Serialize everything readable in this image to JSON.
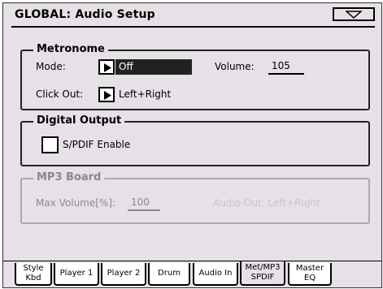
{
  "header": {
    "title": "GLOBAL: Audio Setup"
  },
  "metronome": {
    "title": "Metronome",
    "mode_label": "Mode:",
    "mode_value": "Off",
    "volume_label": "Volume:",
    "volume_value": "105",
    "click_out_label": "Click Out:",
    "click_out_value": "Left+Right"
  },
  "digital_output": {
    "title": "Digital Output",
    "spdif_label": "S/PDIF Enable",
    "spdif_checked": false
  },
  "mp3_board": {
    "title": "MP3 Board",
    "max_volume_label": "Max Volume[%]:",
    "max_volume_value": "100",
    "audio_out_text": "Audio Out: Left+Right"
  },
  "tabs": [
    {
      "line1": "Style",
      "line2": "Kbd",
      "active": false
    },
    {
      "line1": "Player 1",
      "line2": "",
      "active": false
    },
    {
      "line1": "Player 2",
      "line2": "",
      "active": false
    },
    {
      "line1": "Drum",
      "line2": "",
      "active": false
    },
    {
      "line1": "Audio In",
      "line2": "",
      "active": false
    },
    {
      "line1": "Met/MP3",
      "line2": "SPDIF",
      "active": true
    },
    {
      "line1": "Master",
      "line2": "EQ",
      "active": false
    }
  ],
  "icons": {
    "menu": "chevron-down-icon",
    "selector": "triangle-right-icon"
  }
}
